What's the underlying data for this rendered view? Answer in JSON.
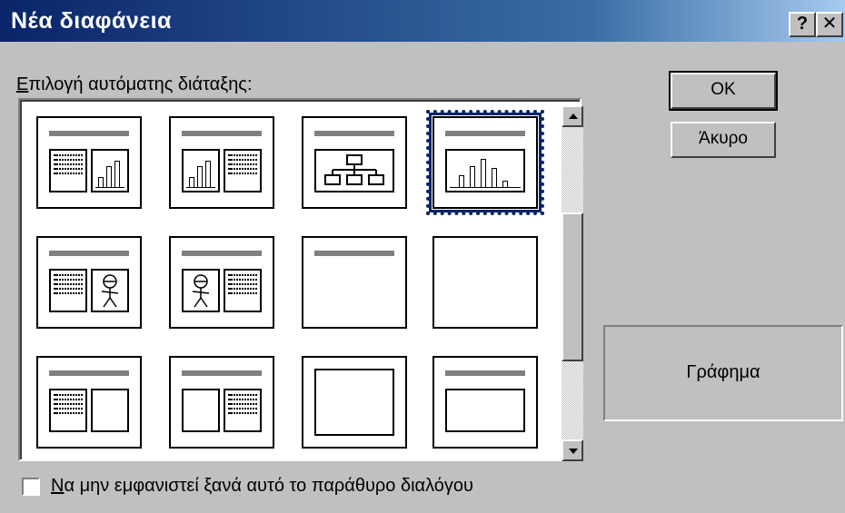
{
  "window": {
    "title": "Νέα διαφάνεια",
    "help_glyph": "?",
    "close_glyph": "✕"
  },
  "layout_picker": {
    "label_mnemonic": "Ε",
    "label_rest": "πιλογή αυτόματης διάταξης:",
    "selected_layout": "Γράφημα",
    "layouts": [
      "Κείμενο και γράφημα",
      "Γράφημα και κείμενο",
      "Οργανόγραμμα",
      "Γράφημα",
      "Κείμενο και εικόνα",
      "Εικόνα και κείμενο",
      "Μόνο τίτλος",
      "Κενή",
      "Κείμενο και αντικείμενο",
      "Αντικείμενο και κείμενο",
      "Αντικείμενο",
      "Τίτλος και αντικείμενο"
    ]
  },
  "buttons": {
    "ok": "OK",
    "cancel": "Άκυρο"
  },
  "preview": {
    "label": "Γράφημα"
  },
  "footer": {
    "checkbox_mnemonic": "Ν",
    "checkbox_rest": "α μην εμφανιστεί ξανά αυτό το παράθυρο διαλόγου",
    "checked": false
  }
}
